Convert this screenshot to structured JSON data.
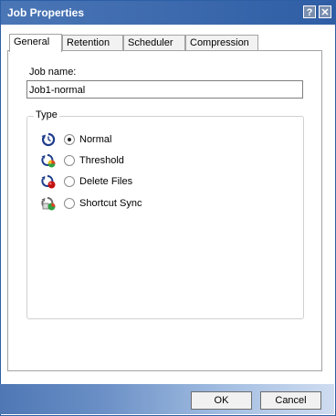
{
  "window": {
    "title": "Job Properties"
  },
  "tabs": [
    {
      "label": "General",
      "active": true
    },
    {
      "label": "Retention",
      "active": false
    },
    {
      "label": "Scheduler",
      "active": false
    },
    {
      "label": "Compression",
      "active": false
    }
  ],
  "general": {
    "job_name_label": "Job name:",
    "job_name_value": "Job1-normal",
    "type_group_label": "Type",
    "options": [
      {
        "label": "Normal",
        "selected": true,
        "icon": "job-normal-icon"
      },
      {
        "label": "Threshold",
        "selected": false,
        "icon": "job-threshold-icon"
      },
      {
        "label": "Delete Files",
        "selected": false,
        "icon": "job-delete-icon"
      },
      {
        "label": "Shortcut Sync",
        "selected": false,
        "icon": "job-shortcut-sync-icon"
      }
    ]
  },
  "buttons": {
    "ok": "OK",
    "cancel": "Cancel"
  },
  "colors": {
    "titlebar": "#3c69ad",
    "accent": "#2f5ea5"
  }
}
